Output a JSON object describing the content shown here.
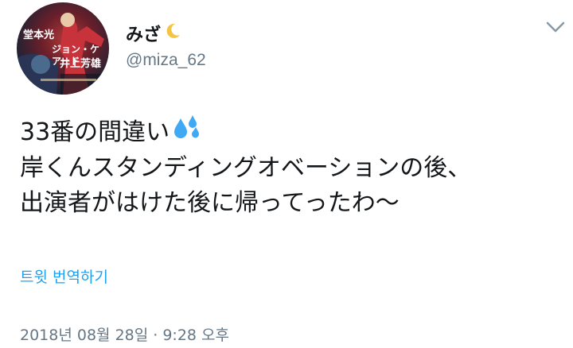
{
  "tweet": {
    "user": {
      "display_name": "みざ",
      "handle": "@miza_62",
      "avatar_poster_lines": [
        "堂本光",
        "ジョン・ケアード",
        "井上芳雄"
      ]
    },
    "text_lines": [
      "33番の間違い",
      "岸くんスタンディングオベーションの後、",
      "出演者がはけた後に帰ってったわ〜"
    ],
    "emoji": {
      "name_suffix": "crescent-moon-icon",
      "line1": "sweat-droplets-icon"
    },
    "translate_label": "트윗 번역하기",
    "timestamp": "2018년 08월 28일 · 9:28 오후",
    "colors": {
      "link": "#1da1f2",
      "secondary": "#657786",
      "text": "#14171a",
      "moon": "#f4c542",
      "droplets": "#3fa9f5"
    }
  }
}
